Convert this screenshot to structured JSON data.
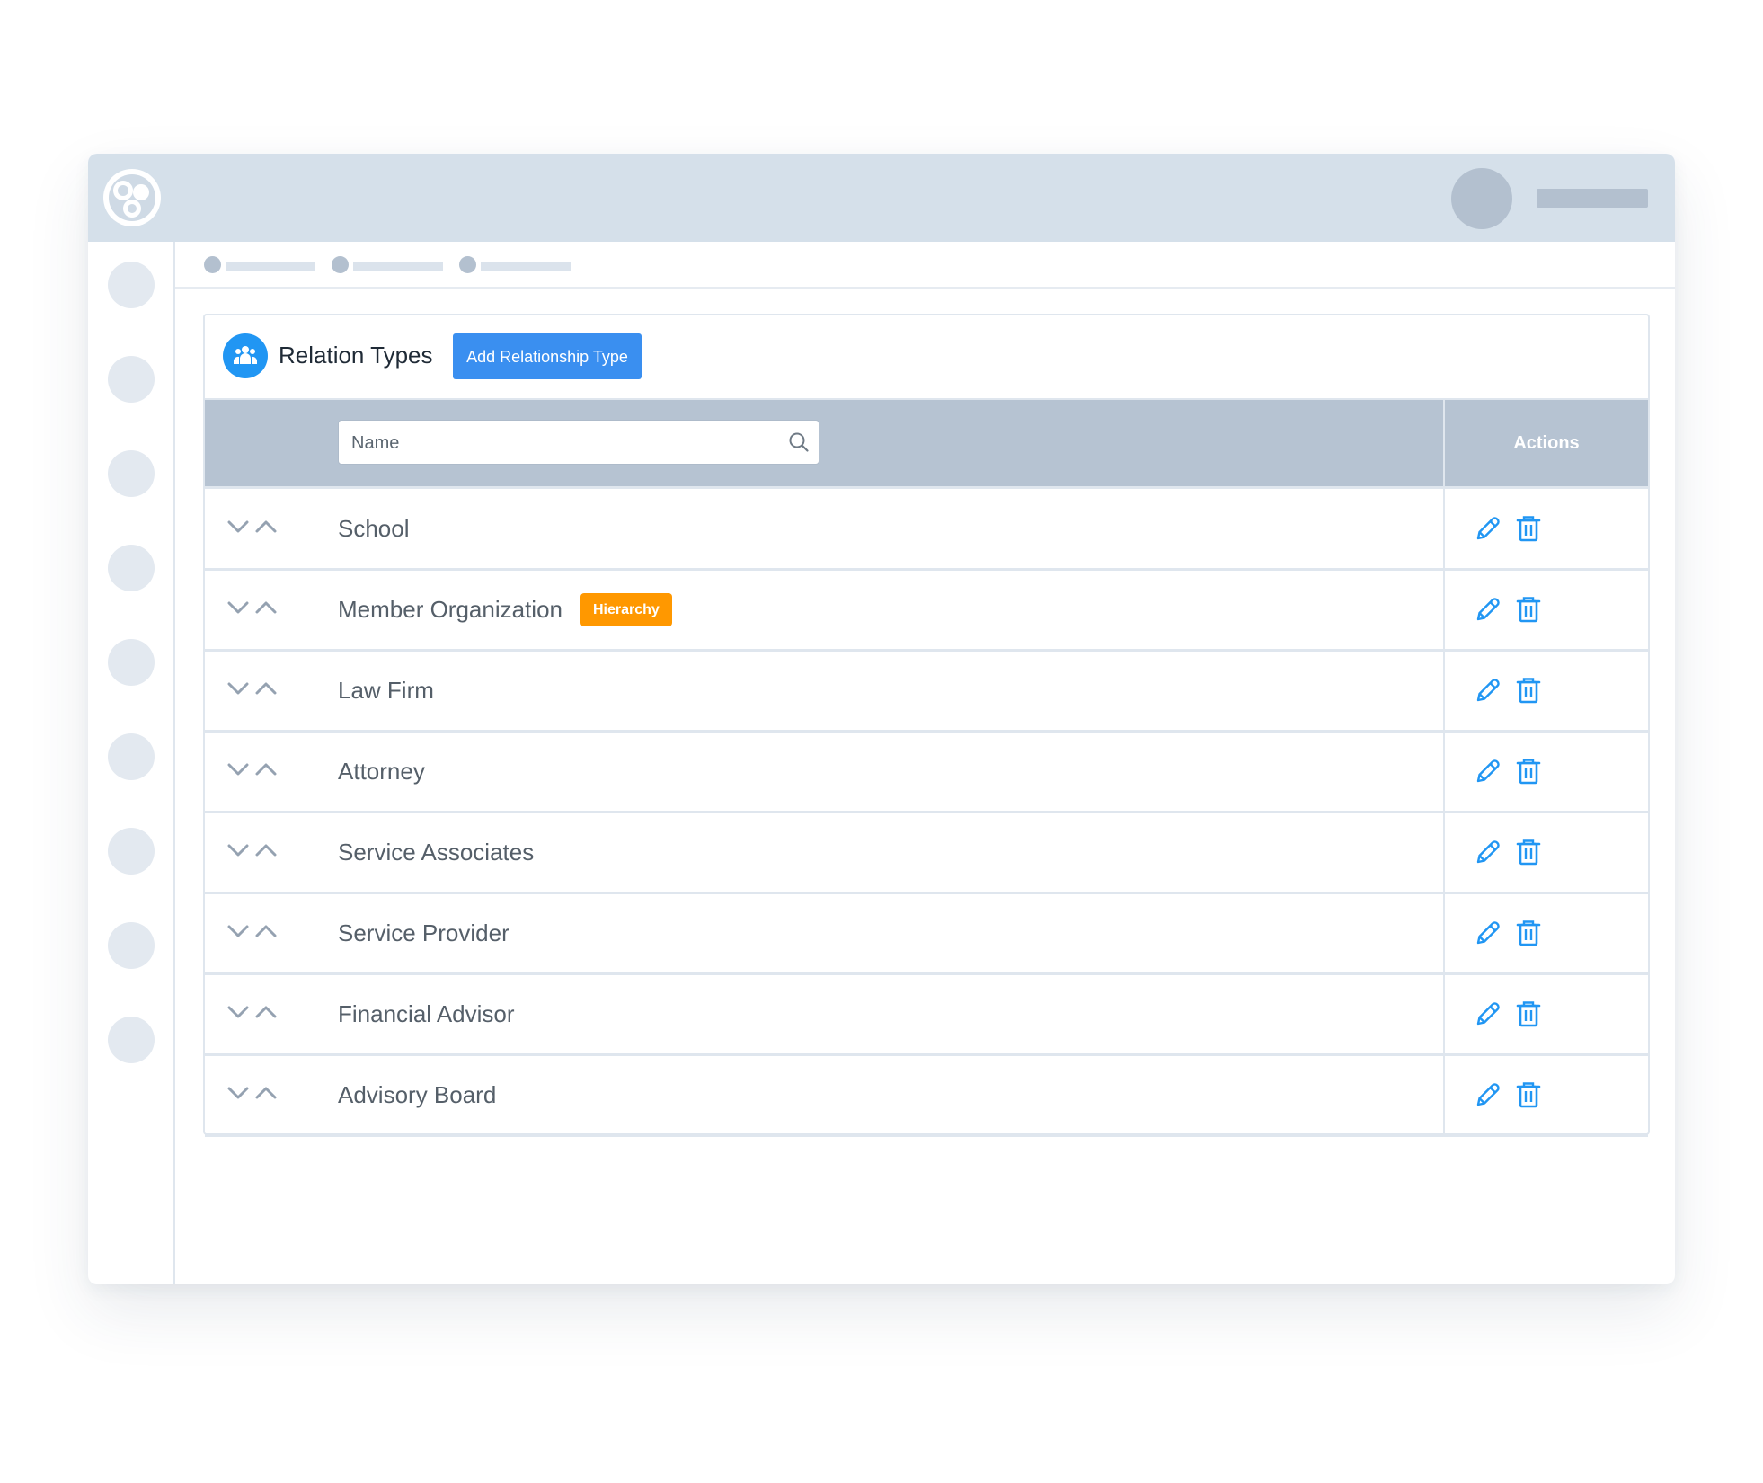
{
  "panel": {
    "title": "Relation Types",
    "add_button_label": "Add Relationship Type",
    "icon": "people-group-icon"
  },
  "table": {
    "search_placeholder": "Name",
    "actions_header": "Actions",
    "rows": [
      {
        "name": "School",
        "badge": ""
      },
      {
        "name": "Member Organization",
        "badge": "Hierarchy"
      },
      {
        "name": "Law Firm",
        "badge": ""
      },
      {
        "name": "Attorney",
        "badge": ""
      },
      {
        "name": "Service Associates",
        "badge": ""
      },
      {
        "name": "Service Provider",
        "badge": ""
      },
      {
        "name": "Financial Advisor",
        "badge": ""
      },
      {
        "name": "Advisory Board",
        "badge": ""
      }
    ]
  },
  "colors": {
    "accent": "#2196f3",
    "button": "#3a8ff0",
    "badge": "#ff9800",
    "header": "#b6c3d2",
    "topbar": "#d5e0ea"
  }
}
